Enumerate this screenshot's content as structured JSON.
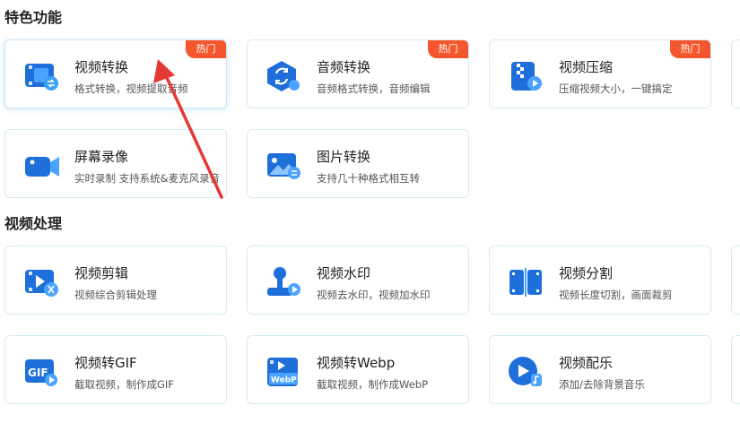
{
  "sections": [
    {
      "title": "特色功能"
    },
    {
      "title": "视频处理"
    }
  ],
  "cards": [
    {
      "title": "视频转换",
      "desc": "格式转换，视频提取音频",
      "badge": "热门",
      "icon": "video-convert-icon"
    },
    {
      "title": "音频转换",
      "desc": "音频格式转换，音频编辑",
      "badge": "热门",
      "icon": "audio-convert-icon"
    },
    {
      "title": "视频压缩",
      "desc": "压缩视频大小，一键搞定",
      "badge": "热门",
      "icon": "video-compress-icon"
    },
    {
      "title": "屏幕录像",
      "desc": "实时录制 支持系统&麦克风录音",
      "icon": "screen-record-icon"
    },
    {
      "title": "图片转换",
      "desc": "支持几十种格式相互转",
      "icon": "image-convert-icon"
    },
    {
      "title": "视频剪辑",
      "desc": "视频综合剪辑处理",
      "icon": "video-edit-icon"
    },
    {
      "title": "视频水印",
      "desc": "视频去水印，视频加水印",
      "icon": "video-watermark-icon"
    },
    {
      "title": "视频分割",
      "desc": "视频长度切割，画面裁剪",
      "icon": "video-split-icon"
    },
    {
      "title": "视频转GIF",
      "desc": "截取视频，制作成GIF",
      "icon": "video-to-gif-icon",
      "icon_text": "GIF"
    },
    {
      "title": "视频转Webp",
      "desc": "截取视频，制作成WebP",
      "icon": "video-to-webp-icon",
      "icon_text": "WebP"
    },
    {
      "title": "视频配乐",
      "desc": "添加/去除背景音乐",
      "icon": "video-music-icon"
    }
  ],
  "colors": {
    "accent": "#1e88e5",
    "badge": "#f4572d",
    "arrow": "#e53935"
  }
}
